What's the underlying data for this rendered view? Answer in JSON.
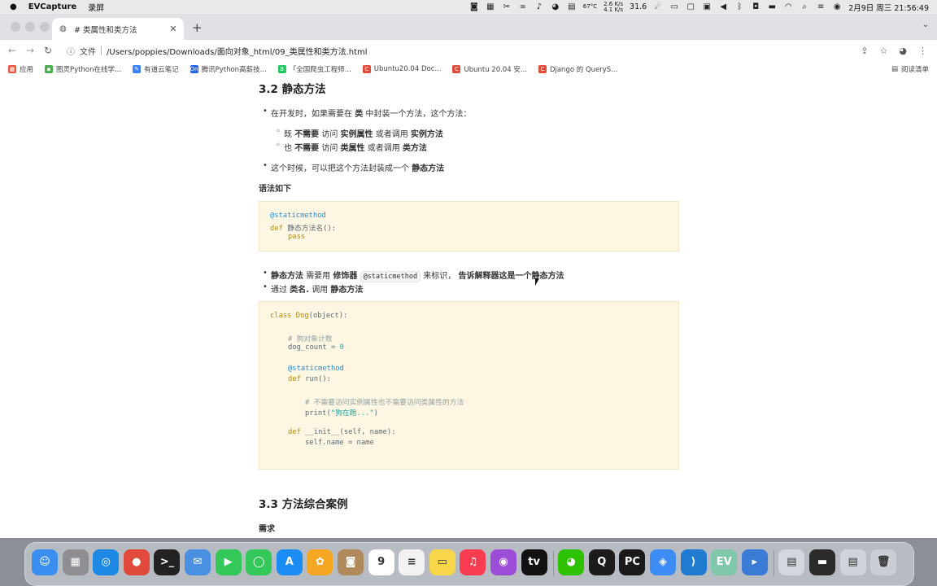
{
  "menubar": {
    "app_name": "EVCapture",
    "menu_item": "录屏",
    "temp": "67°C",
    "net_up": "2.6 K/s",
    "net_down": "4.1 K/s",
    "cpu": "31.6",
    "datetime": "2月9日 周三 21:56:49"
  },
  "browser": {
    "tab_title": "# 类属性和类方法",
    "url_label": "文件",
    "url": "/Users/poppies/Downloads/面向对象_html/09_类属性和类方法.html",
    "bookmarks": [
      {
        "label": "应用",
        "icon": "apps-grid-icon",
        "color": "#e8553e"
      },
      {
        "label": "图灵Python在线学...",
        "icon": "turing-icon",
        "color": "#4caf50"
      },
      {
        "label": "有道云笔记",
        "icon": "youdao-icon",
        "color": "#3b82f6"
      },
      {
        "label": "腾讯Python高薪技...",
        "icon": "tencent-icon",
        "color": "#2563eb"
      },
      {
        "label": "「全国爬虫工程师...",
        "icon": "b-icon",
        "color": "#22c55e"
      },
      {
        "label": "Ubuntu20.04 Doc...",
        "icon": "csdn-icon",
        "color": "#e24c3b"
      },
      {
        "label": "Ubuntu 20.04 安...",
        "icon": "csdn-icon",
        "color": "#e24c3b"
      },
      {
        "label": "Django 的 QueryS...",
        "icon": "c-icon",
        "color": "#e24c3b"
      }
    ],
    "reading_list": "阅读清单"
  },
  "content": {
    "h_static": "3.2 静态方法",
    "b1_pre": "在开发时，如果需要在",
    "b1_class": "类",
    "b1_post": "中封装一个方法，这个方法：",
    "s1_a": "既",
    "s1_b": "不需要",
    "s1_c": "访问",
    "s1_d": "实例属性",
    "s1_e": "或者调用",
    "s1_f": "实例方法",
    "s2_a": "也",
    "s2_b": "不需要",
    "s2_c": "访问",
    "s2_d": "类属性",
    "s2_e": "或者调用",
    "s2_f": "类方法",
    "b2_pre": "这个时候，可以把这个方法封装成一个",
    "b2_bold": "静态方法",
    "syntax": "语法如下",
    "code1": {
      "l1": "@staticmethod",
      "l2_kw": "def",
      "l2_rest": " 静态方法名():",
      "l3_kw": "pass"
    },
    "b3_a": "静态方法",
    "b3_b": "需要用",
    "b3_c": "修饰器",
    "b3_code": "@staticmethod",
    "b3_d": "来标识，",
    "b3_e": "告诉解释器这是一个静态方法",
    "b4_a": "通过",
    "b4_b": "类名.",
    "b4_c": "调用",
    "b4_d": "静态方法",
    "code2": {
      "l1_kw": "class",
      "l1_name": "Dog",
      "l1_rest": "(object):",
      "l2": "# 狗对象计数",
      "l3_var": "dog_count = ",
      "l3_num": "0",
      "l4": "@staticmethod",
      "l5_kw": "def",
      "l5_rest": " run():",
      "l6": "# 不需要访问实例属性也不需要访问类属性的方法",
      "l7_fn": "print(",
      "l7_str": "\"狗在跑...\"",
      "l7_end": ")",
      "l8_kw": "def",
      "l8_rest": " __init__(self, name):",
      "l9": "self.name = name"
    },
    "h_case": "3.3 方法综合案例",
    "need": "需求"
  },
  "dock": {
    "apps": [
      {
        "icon": "finder-icon",
        "color": "#3b8ff0",
        "glyph": "☺"
      },
      {
        "icon": "launchpad-icon",
        "color": "#8e8e93",
        "glyph": "▦"
      },
      {
        "icon": "safari-icon",
        "color": "#1e88e5",
        "glyph": "◎"
      },
      {
        "icon": "chrome-icon",
        "color": "#e0493b",
        "glyph": "●"
      },
      {
        "icon": "terminal-icon",
        "color": "#222222",
        "glyph": ">_"
      },
      {
        "icon": "mail-icon",
        "color": "#4a90e2",
        "glyph": "✉"
      },
      {
        "icon": "facetime-icon",
        "color": "#34c759",
        "glyph": "▶"
      },
      {
        "icon": "messages-icon",
        "color": "#34c759",
        "glyph": "◯"
      },
      {
        "icon": "appstore-icon",
        "color": "#1c8cf5",
        "glyph": "A"
      },
      {
        "icon": "photos-icon",
        "color": "#f5a623",
        "glyph": "✿"
      },
      {
        "icon": "contacts-icon",
        "color": "#b08a5a",
        "glyph": "◙"
      },
      {
        "icon": "calendar-icon",
        "color": "#ffffff",
        "glyph": "9"
      },
      {
        "icon": "reminders-icon",
        "color": "#f2f2f2",
        "glyph": "≡"
      },
      {
        "icon": "notes-icon",
        "color": "#f7d64a",
        "glyph": "▭"
      },
      {
        "icon": "music-icon",
        "color": "#fa3c50",
        "glyph": "♫"
      },
      {
        "icon": "podcasts-icon",
        "color": "#9b4dd8",
        "glyph": "◉"
      },
      {
        "icon": "appletv-icon",
        "color": "#111111",
        "glyph": "tv"
      },
      {
        "icon": "wechat-icon",
        "color": "#2dc100",
        "glyph": "◕"
      },
      {
        "icon": "qq-icon",
        "color": "#1b1b1b",
        "glyph": "Q"
      },
      {
        "icon": "pycharm-icon",
        "color": "#1a1a1a",
        "glyph": "PC"
      },
      {
        "icon": "baidu-netdisk-icon",
        "color": "#3d8df5",
        "glyph": "◈"
      },
      {
        "icon": "vscode-icon",
        "color": "#1f7ad0",
        "glyph": "⟩"
      },
      {
        "icon": "evcapture-icon",
        "color": "#7fc8a9",
        "glyph": "EV"
      },
      {
        "icon": "screen-recorder-icon",
        "color": "#3a7bd5",
        "glyph": "▸"
      },
      {
        "icon": "preview-thumb-icon",
        "color": "#d4d8de",
        "glyph": "▤"
      },
      {
        "icon": "terminal-thumb-icon",
        "color": "#2b2b2b",
        "glyph": "▬"
      },
      {
        "icon": "screenshot-thumb-icon",
        "color": "#cfd4da",
        "glyph": "▤"
      },
      {
        "icon": "trash-icon",
        "color": "#c9ced4",
        "glyph": "🗑"
      }
    ]
  }
}
